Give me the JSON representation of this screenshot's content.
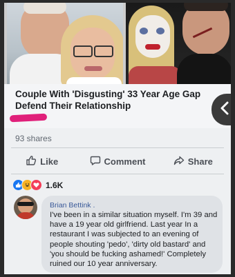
{
  "post": {
    "headline": "Couple With 'Disgusting' 33 Year Age Gap Defend Their Relationship",
    "shares": "93 shares"
  },
  "actions": {
    "like": "Like",
    "comment": "Comment",
    "share": "Share"
  },
  "reactions": {
    "icons": [
      "like-icon",
      "haha-icon",
      "love-icon"
    ],
    "count": "1.6K"
  },
  "comment": {
    "author": "Brian Bettink .",
    "text": "I've been in a similar situation  myself. I'm 39 and have a 19 year old girlfriend. Last year In a restaurant I was subjected to an evening of people shouting 'pedo', 'dirty old bastard' and 'you should be fucking ashamed!' Completely ruined our 10 year anniversary."
  },
  "colors": {
    "link": "#385898",
    "highlight": "#e0207a",
    "like_blue": "#1877f2",
    "haha_yellow": "#f7b125",
    "love_red": "#f33e58"
  }
}
